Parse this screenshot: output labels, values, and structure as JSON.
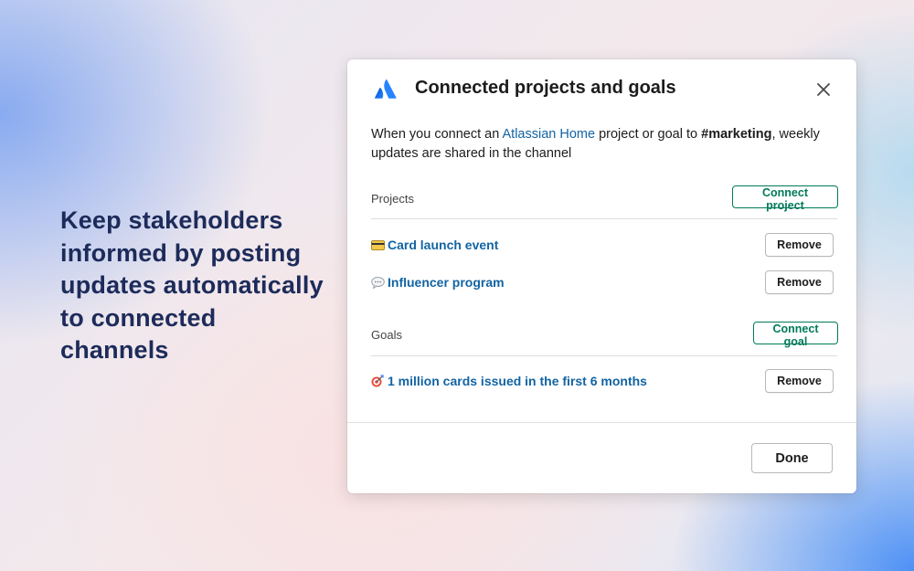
{
  "tagline": "Keep stakeholders informed by posting updates automatically to connected channels",
  "modal": {
    "title": "Connected projects and goals",
    "logo_icon": "atlassian-logo",
    "close_icon": "close-icon",
    "description": {
      "prefix": "When you connect an ",
      "link": "Atlassian Home",
      "middle": " project or goal to ",
      "channel": "#marketing",
      "suffix": ", weekly updates are shared in the channel"
    },
    "projects": {
      "label": "Projects",
      "connect_label": "Connect project",
      "items": [
        {
          "icon": "credit-card-emoji",
          "label": "Card launch event",
          "remove_label": "Remove"
        },
        {
          "icon": "speech-bubble-emoji",
          "label": "Influencer program",
          "remove_label": "Remove"
        }
      ]
    },
    "goals": {
      "label": "Goals",
      "connect_label": "Connect goal",
      "items": [
        {
          "icon": "target-emoji",
          "label": "1 million cards issued in the first 6 months",
          "remove_label": "Remove"
        }
      ]
    },
    "done_label": "Done"
  },
  "colors": {
    "tagline": "#1d2b5a",
    "link": "#1264a3",
    "accent_green": "#007a5a",
    "atlassian_blue": "#2684ff"
  }
}
